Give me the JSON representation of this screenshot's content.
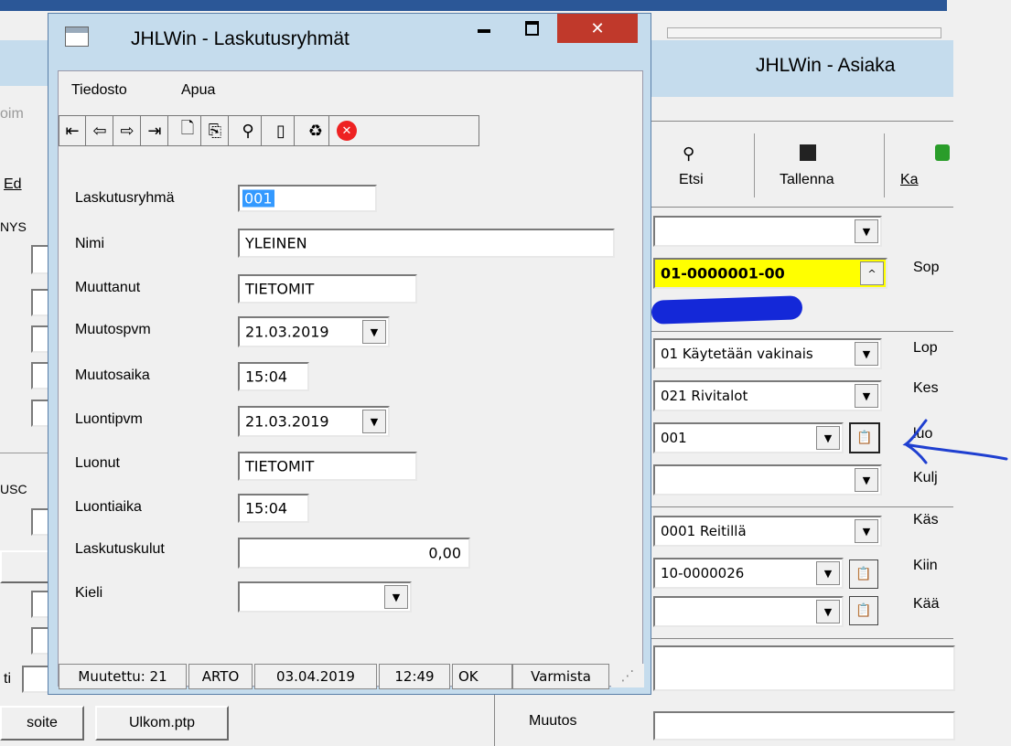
{
  "background_window": {
    "title": "JHLWin - Asiaka",
    "toolbar": {
      "etsi_label": "Etsi",
      "tallenna_label": "Tallenna",
      "ka_label": "Ka"
    },
    "left_labels": {
      "oim": "oim",
      "ed": "Ed",
      "nys": "NYS",
      "usc": "USC",
      "ti": "ti"
    },
    "fields": {
      "customer_number": "01-0000001-00",
      "kaytto": "01 Käytetään vakinais",
      "talotyyppi": "021 Rivitalot",
      "laskutusryhma": "001",
      "reitti": "0001 Reitillä",
      "kiinteisto": "10-0000026"
    },
    "right_labels": [
      "Sop",
      "Lop",
      "Kes",
      "luo",
      "Kulj",
      "Käs",
      "Kiin",
      "Kää"
    ],
    "bottom": {
      "osoite_button": "soite",
      "ulkom_button": "Ulkom.ptp",
      "muutos_label": "Muutos"
    },
    "colors": {
      "customer_number_bg": "#ffff00",
      "annotation_arrow": "#1f3fd0",
      "redaction": "#1428d8"
    }
  },
  "dialog": {
    "title": "JHLWin - Laskutusryhmät",
    "menu": [
      "Tiedosto",
      "Apua"
    ],
    "toolbar_icons": [
      "first-record-icon",
      "previous-record-icon",
      "next-record-icon",
      "last-record-icon",
      "new-record-icon",
      "copy-record-icon",
      "find-icon",
      "blank-icon",
      "recycle-delete-icon",
      "close-red-icon"
    ],
    "form": {
      "laskutusryhma_label": "Laskutusryhmä",
      "laskutusryhma_value": "001",
      "nimi_label": "Nimi",
      "nimi_value": "YLEINEN",
      "muuttanut_label": "Muuttanut",
      "muuttanut_value": "TIETOMIT",
      "muutospvm_label": "Muutospvm",
      "muutospvm_value": "21.03.2019",
      "muutosaika_label": "Muutosaika",
      "muutosaika_value": "15:04",
      "luontipvm_label": "Luontipvm",
      "luontipvm_value": "21.03.2019",
      "luonut_label": "Luonut",
      "luonut_value": "TIETOMIT",
      "luontiaika_label": "Luontiaika",
      "luontiaika_value": "15:04",
      "laskutuskulut_label": "Laskutuskulut",
      "laskutuskulut_value": "0,00",
      "kieli_label": "Kieli",
      "kieli_value": ""
    },
    "status": {
      "muutettu": "Muutettu: 21",
      "user": "ARTO",
      "date": "03.04.2019",
      "time": "12:49",
      "ok": "OK",
      "varmista": "Varmista"
    },
    "colors": {
      "frame": "#c5dced",
      "close_button": "#c0392b",
      "selection": "#3399ff"
    }
  }
}
